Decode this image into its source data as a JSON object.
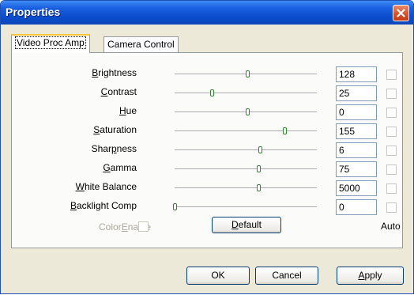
{
  "window": {
    "title": "Properties"
  },
  "tabs": [
    {
      "label": "Video Proc Amp",
      "active": true
    },
    {
      "label": "Camera Control",
      "active": false
    }
  ],
  "controls": [
    {
      "label": "Brightness",
      "mnemonic": "B",
      "label_rest": "rightness",
      "value": "128",
      "slider_fraction": 0.51,
      "auto": false
    },
    {
      "label": "Contrast",
      "mnemonic": "C",
      "label_rest": "ontrast",
      "value": "25",
      "slider_fraction": 0.26,
      "auto": false
    },
    {
      "label": "Hue",
      "mnemonic": "H",
      "label_rest": "ue",
      "value": "0",
      "slider_fraction": 0.51,
      "auto": false
    },
    {
      "label": "Saturation",
      "mnemonic": "S",
      "label_rest": "aturation",
      "value": "155",
      "slider_fraction": 0.77,
      "auto": false
    },
    {
      "label": "Sharpness",
      "pre": "Shar",
      "mnemonic": "p",
      "label_rest": "ness",
      "value": "6",
      "slider_fraction": 0.6,
      "auto": false
    },
    {
      "label": "Gamma",
      "mnemonic": "G",
      "label_rest": "amma",
      "value": "75",
      "slider_fraction": 0.59,
      "auto": false
    },
    {
      "label": "White Balance",
      "mnemonic": "W",
      "label_rest": "hite Balance",
      "value": "5000",
      "slider_fraction": 0.59,
      "auto": false
    },
    {
      "label": "Backlight Comp",
      "mnemonic": "B",
      "label_rest": "acklight Comp",
      "value": "0",
      "slider_fraction": 0.0,
      "auto": false
    }
  ],
  "color_enable": {
    "pre": "Color",
    "mnemonic": "E",
    "rest": "nable",
    "checked": false,
    "enabled": false
  },
  "default_button": {
    "mnemonic": "D",
    "rest": "efault"
  },
  "auto_header": "Auto",
  "buttons": {
    "ok": "OK",
    "cancel": "Cancel",
    "apply_mnemonic": "A",
    "apply_rest": "pply"
  }
}
